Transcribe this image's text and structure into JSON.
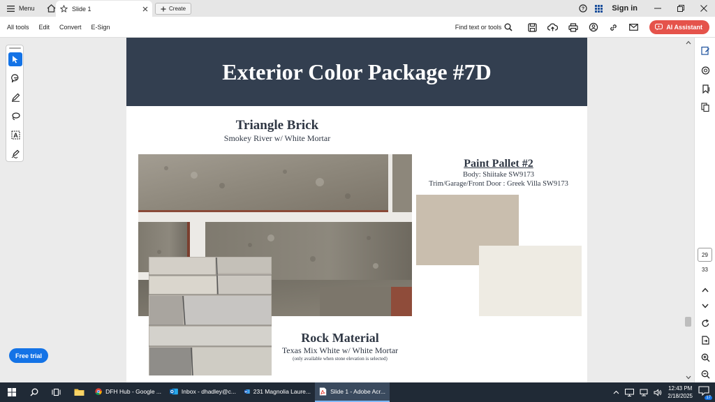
{
  "titlebar": {
    "menu_label": "Menu",
    "tab_title": "Slide 1",
    "create_label": "Create",
    "signin_label": "Sign in"
  },
  "toolbar": {
    "items": [
      "All tools",
      "Edit",
      "Convert",
      "E-Sign"
    ],
    "find_label": "Find text or tools",
    "ai_label": "AI Assistant"
  },
  "left_tools": [
    "select-tool",
    "comment-tool",
    "highlight-tool",
    "draw-tool",
    "text-tool",
    "sign-tool"
  ],
  "free_trial_label": "Free trial",
  "document": {
    "title": "Exterior Color Package #7D",
    "brick": {
      "title": "Triangle Brick",
      "subtitle": "Smokey River w/ White Mortar"
    },
    "rock": {
      "title": "Rock Material",
      "subtitle": "Texas Mix White w/ White Mortar",
      "note": "(only available when stone elevation is selected)"
    },
    "paint": {
      "title": "Paint Pallet #2",
      "body": "Body: Shiitake SW9173",
      "trim": "Trim/Garage/Front Door : Greek Villa SW9173"
    },
    "colors": {
      "banner": "#333f50",
      "swatch_body": "#c9beae",
      "swatch_trim": "#eeebe3"
    }
  },
  "pager": {
    "current": "29",
    "total": "33"
  },
  "taskbar": {
    "apps": [
      {
        "label": "DFH Hub - Google ...",
        "icon": "chrome-icon"
      },
      {
        "label": "Inbox - dhadley@c...",
        "icon": "outlook-icon"
      },
      {
        "label": "231 Magnolia Laure...",
        "icon": "word-icon"
      },
      {
        "label": "Slide 1 - Adobe Acr...",
        "icon": "acrobat-icon"
      }
    ],
    "time": "12:43 PM",
    "date": "2/18/2025",
    "notification_count": "17"
  }
}
